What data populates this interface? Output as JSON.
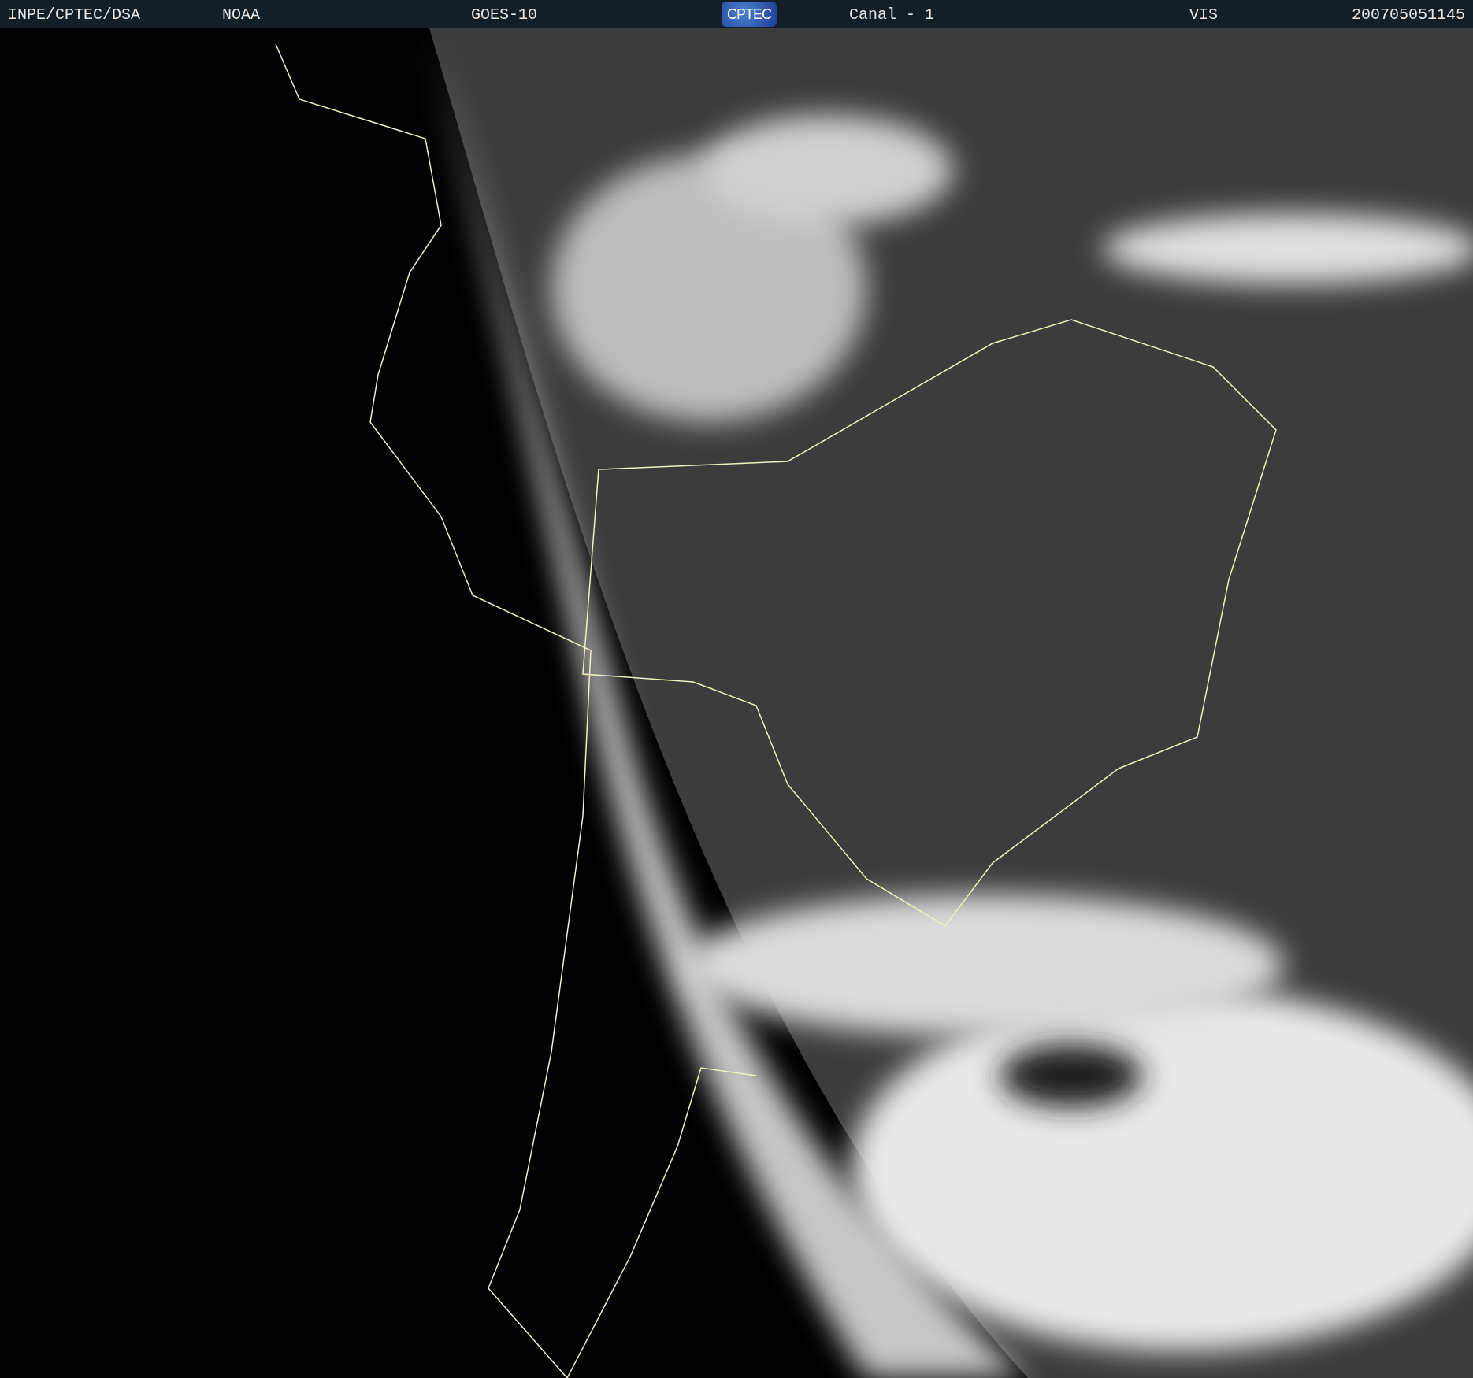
{
  "header": {
    "items": [
      {
        "kind": "text",
        "text": "INPE/CPTEC/DSA"
      },
      {
        "kind": "text",
        "text": "NOAA"
      },
      {
        "kind": "text",
        "text": "GOES-10"
      },
      {
        "kind": "logo",
        "text": "CPTEC"
      },
      {
        "kind": "text",
        "text": "Canal - 1"
      },
      {
        "kind": "text",
        "text": "VIS"
      },
      {
        "kind": "text",
        "text": "200705051145"
      }
    ]
  }
}
